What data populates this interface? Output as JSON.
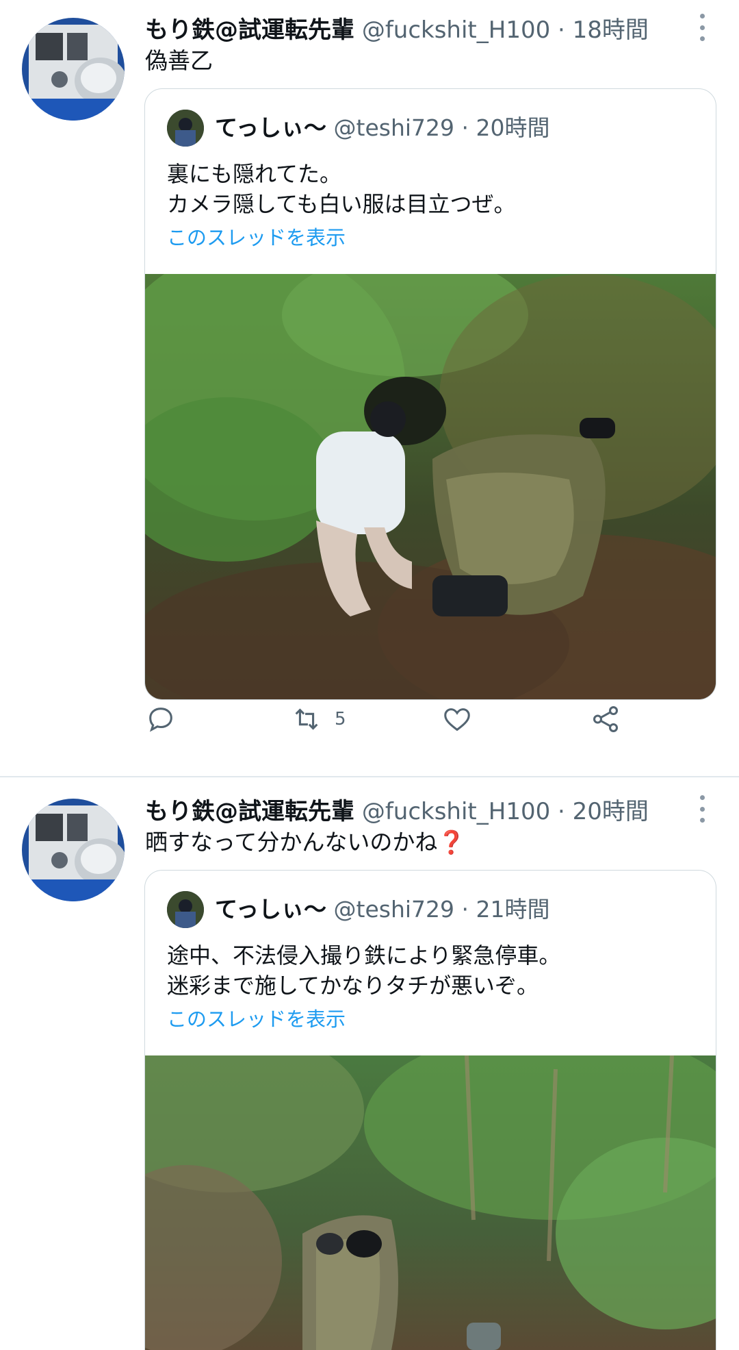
{
  "tweets": [
    {
      "author_name": "もり鉄@試運転先輩",
      "author_handle": "@fuckshit_H100",
      "time": "18時間",
      "text": "偽善乙",
      "quoted": {
        "author_name": "てっしぃ〜",
        "author_handle": "@teshi729",
        "time": "20時間",
        "line1": "裏にも隠れてた。",
        "line2": "カメラ隠しても白い服は目立つぜ。",
        "thread_link": "このスレッドを表示"
      },
      "actions": {
        "reply_count": "",
        "retweet_count": "5",
        "like_count": ""
      }
    },
    {
      "author_name": "もり鉄@試運転先輩",
      "author_handle": "@fuckshit_H100",
      "time": "20時間",
      "text": "晒すなって分かんないのかね",
      "text_emoji": "❓",
      "quoted": {
        "author_name": "てっしぃ〜",
        "author_handle": "@teshi729",
        "time": "21時間",
        "line1": "途中、不法侵入撮り鉄により緊急停車。",
        "line2": "迷彩まで施してかなりタチが悪いぞ。",
        "thread_link": "このスレッドを表示"
      }
    }
  ],
  "separator": "·",
  "colors": {
    "link": "#1d9bf0",
    "secondary_text": "#536471",
    "border": "#cfd9de"
  }
}
